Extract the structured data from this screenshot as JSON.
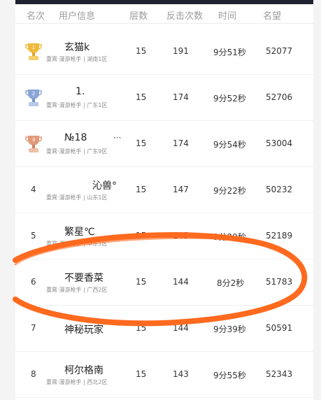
{
  "header": {
    "rank": "名次",
    "user": "用户信息",
    "floor": "层数",
    "counter": "反击次数",
    "time": "时间",
    "fame": "名望"
  },
  "rows": [
    {
      "rank": "1",
      "name": "玄猫k",
      "sub": "重霄·漫游枪手 | 湖南1区",
      "floor": "15",
      "counter": "191",
      "time": "9分51秒",
      "fame": "52077"
    },
    {
      "rank": "2",
      "name": "1.",
      "sub": "重霄·漫游枪手 | 广东1区",
      "floor": "15",
      "counter": "174",
      "time": "9分52秒",
      "fame": "52706"
    },
    {
      "rank": "3",
      "name": "№18",
      "extra": "···",
      "sub": "重霄·漫游枪手 | 广东9区",
      "floor": "15",
      "counter": "174",
      "time": "9分54秒",
      "fame": "53004"
    },
    {
      "rank": "4",
      "name": "沁兽°",
      "sub": "重霄·漫游枪手 | 山东1区",
      "floor": "15",
      "counter": "147",
      "time": "9分22秒",
      "fame": "50232"
    },
    {
      "rank": "5",
      "name": "繁星℃",
      "sub": "重霄·漫游枪手 | 华东1区",
      "floor": "15",
      "counter": "145",
      "time": "9分29秒",
      "fame": "52189"
    },
    {
      "rank": "6",
      "name": "不要香菜",
      "sub": "重霄·漫游枪手 | 广西2区",
      "floor": "15",
      "counter": "144",
      "time": "8分2秒",
      "fame": "51783"
    },
    {
      "rank": "7",
      "name": "神秘玩家",
      "sub": "",
      "floor": "15",
      "counter": "144",
      "time": "9分39秒",
      "fame": "50591"
    },
    {
      "rank": "8",
      "name": "柯尔格南",
      "sub": "重霄·漫游枪手 | 西北2区",
      "floor": "15",
      "counter": "143",
      "time": "9分55秒",
      "fame": "52343"
    }
  ],
  "colors": {
    "gold": "#f0b93a",
    "silver": "#8aa6d6",
    "bronze": "#e09a7a",
    "highlight": "#ff6a1f"
  }
}
